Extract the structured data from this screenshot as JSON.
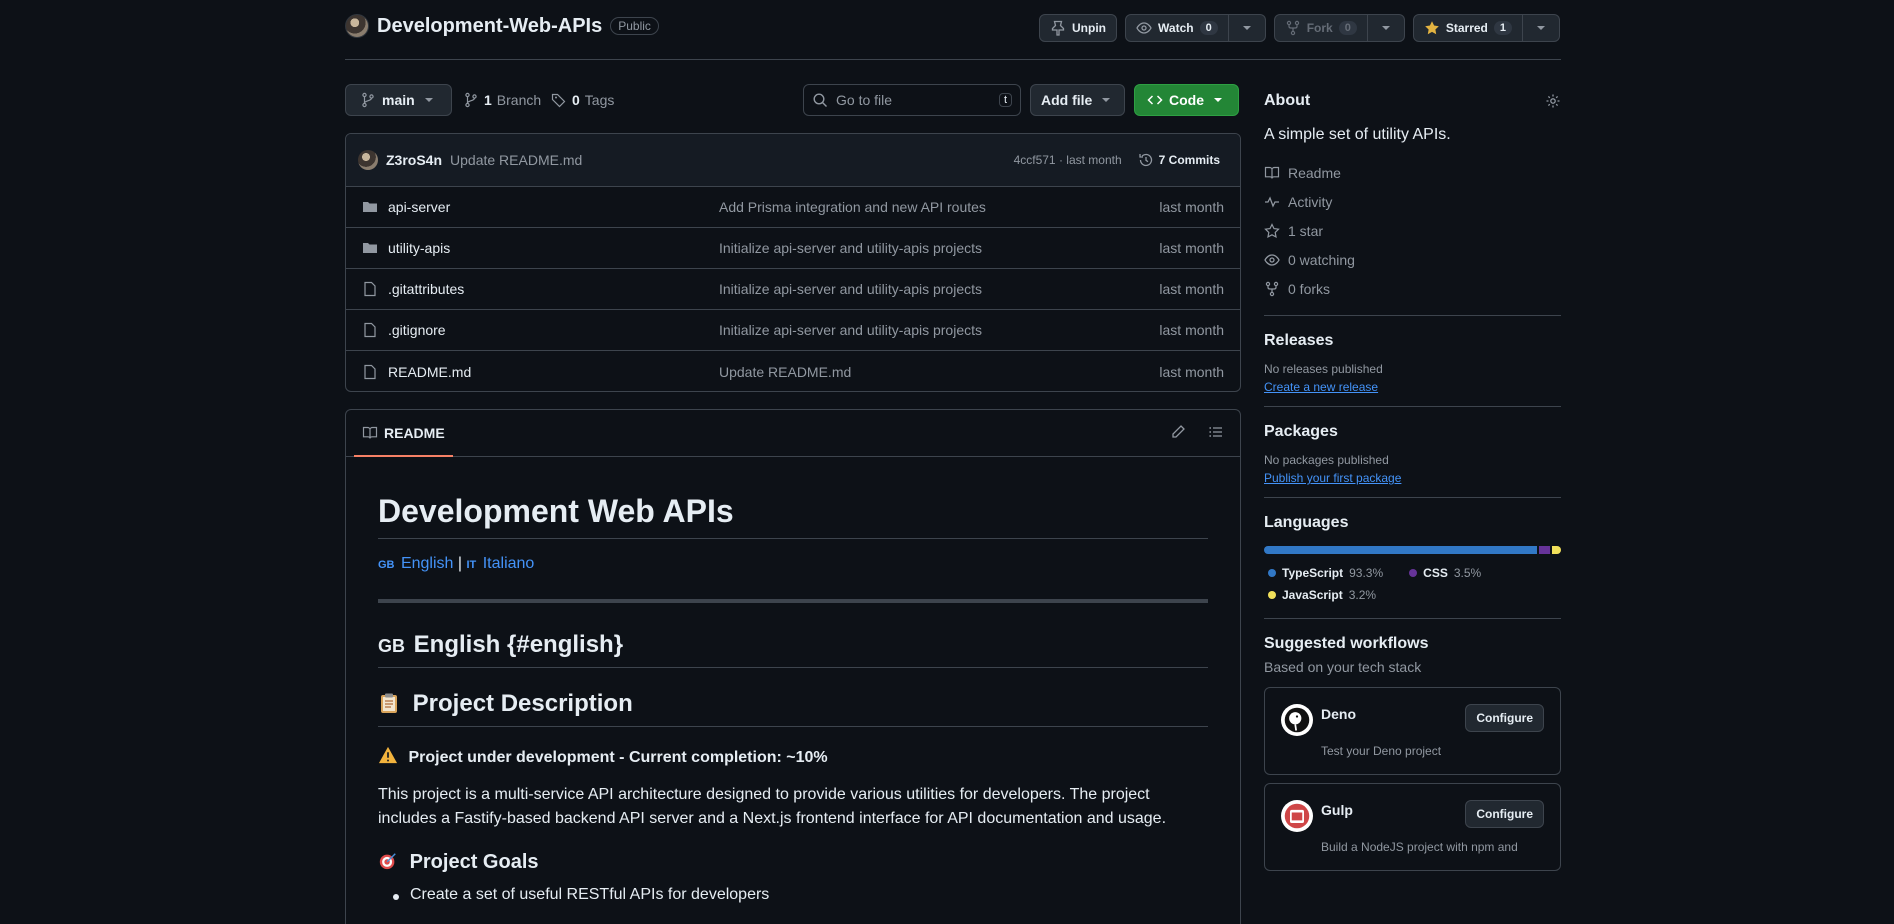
{
  "repo": {
    "name": "Development-Web-APIs",
    "visibility": "Public"
  },
  "header_actions": {
    "unpin": "Unpin",
    "watch": "Watch",
    "watch_count": "0",
    "fork": "Fork",
    "fork_count": "0",
    "starred": "Starred",
    "star_count": "1"
  },
  "toolbar": {
    "branch": "main",
    "branch_count": "1",
    "branch_label": "Branch",
    "tag_count": "0",
    "tag_label": "Tags",
    "search_placeholder": "Go to file",
    "search_shortcut": "t",
    "add_file": "Add file",
    "code": "Code"
  },
  "latest_commit": {
    "author": "Z3roS4n",
    "message": "Update README.md",
    "hash_time": "4ccf571 · last month",
    "commits": "7 Commits"
  },
  "files": [
    {
      "type": "folder",
      "name": "api-server",
      "commit": "Add Prisma integration and new API routes",
      "date": "last month"
    },
    {
      "type": "folder",
      "name": "utility-apis",
      "commit": "Initialize api-server and utility-apis projects",
      "date": "last month"
    },
    {
      "type": "file",
      "name": ".gitattributes",
      "commit": "Initialize api-server and utility-apis projects",
      "date": "last month"
    },
    {
      "type": "file",
      "name": ".gitignore",
      "commit": "Initialize api-server and utility-apis projects",
      "date": "last month"
    },
    {
      "type": "file",
      "name": "README.md",
      "commit": "Update README.md",
      "date": "last month"
    }
  ],
  "readme": {
    "tab": "README",
    "title": "Development Web APIs",
    "lang_en_flag": "GB",
    "lang_en": "English",
    "lang_sep": "|",
    "lang_it_flag": "IT",
    "lang_it": "Italiano",
    "section_flag": "GB",
    "section_title": "English {#english}",
    "desc_heading": "Project Description",
    "status": "Project under development - Current completion: ~10%",
    "paragraph": "This project is a multi-service API architecture designed to provide various utilities for developers. The project includes a Fastify-based backend API server and a Next.js frontend interface for API documentation and usage.",
    "goals_heading": "Project Goals",
    "goal_1": "Create a set of useful RESTful APIs for developers"
  },
  "about": {
    "title": "About",
    "description": "A simple set of utility APIs.",
    "items": [
      {
        "icon": "book-icon",
        "label": "Readme"
      },
      {
        "icon": "pulse-icon",
        "label": "Activity"
      },
      {
        "icon": "star-icon",
        "label": "1 star"
      },
      {
        "icon": "eye-icon",
        "label": "0 watching"
      },
      {
        "icon": "fork-icon",
        "label": "0 forks"
      }
    ]
  },
  "releases": {
    "title": "Releases",
    "empty": "No releases published",
    "link": "Create a new release"
  },
  "packages": {
    "title": "Packages",
    "empty": "No packages published",
    "link": "Publish your first package"
  },
  "languages": {
    "title": "Languages",
    "items": [
      {
        "name": "TypeScript",
        "pct": "93.3%",
        "value": 93.3,
        "color": "#3178c6"
      },
      {
        "name": "CSS",
        "pct": "3.5%",
        "value": 3.5,
        "color": "#663399"
      },
      {
        "name": "JavaScript",
        "pct": "3.2%",
        "value": 3.2,
        "color": "#f1e05a"
      }
    ]
  },
  "workflows": {
    "title": "Suggested workflows",
    "subtitle": "Based on your tech stack",
    "items": [
      {
        "name": "Deno",
        "desc": "Test your Deno project",
        "button": "Configure",
        "color": "#ffffff"
      },
      {
        "name": "Gulp",
        "desc": "Build a NodeJS project with npm and",
        "button": "Configure",
        "color": "#cf4647"
      }
    ]
  },
  "colors": {
    "accent_green": "#238636",
    "link_blue": "#4493f8",
    "tab_underline": "#f78166",
    "star_yellow": "#e3b341"
  }
}
